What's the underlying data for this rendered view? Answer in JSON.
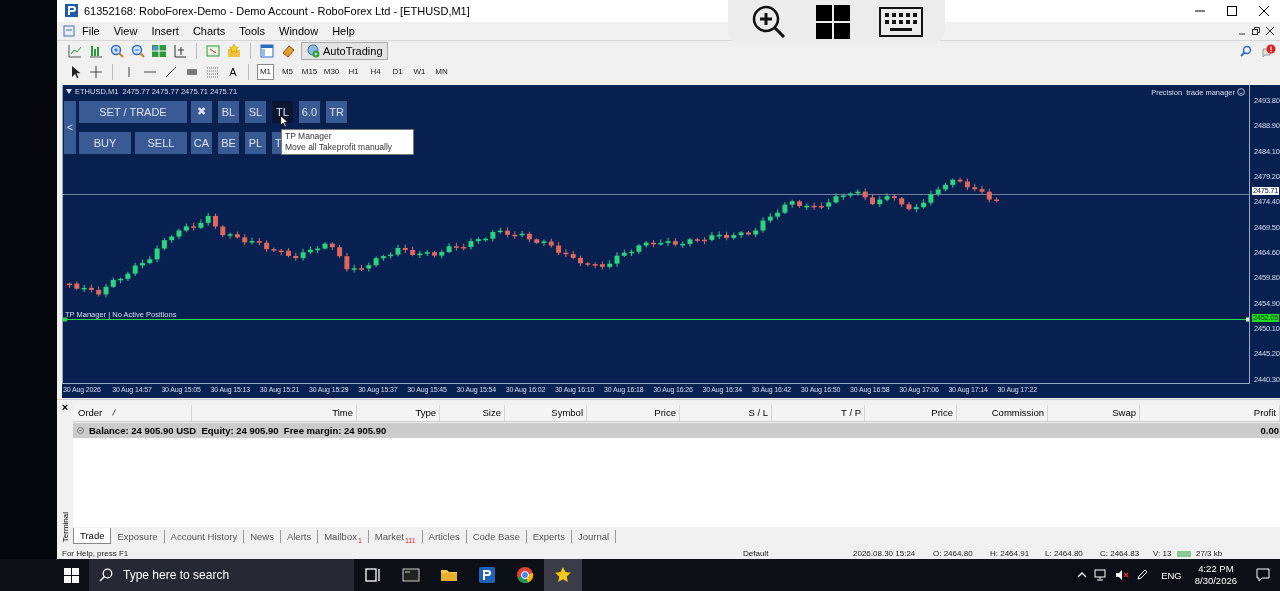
{
  "window": {
    "title": "61352168: RoboForex-Demo - Demo Account - RoboForex Ltd - [ETHUSD,M1]"
  },
  "menu": [
    "File",
    "View",
    "Insert",
    "Charts",
    "Tools",
    "Window",
    "Help"
  ],
  "toolbar": {
    "autotrading": "AutoTrading",
    "text_tool": "A"
  },
  "timeframes": [
    {
      "label": "M1",
      "selected": true
    },
    {
      "label": "M5",
      "selected": false
    },
    {
      "label": "M15",
      "selected": false
    },
    {
      "label": "M30",
      "selected": false
    },
    {
      "label": "H1",
      "selected": false
    },
    {
      "label": "H4",
      "selected": false
    },
    {
      "label": "D1",
      "selected": false
    },
    {
      "label": "W1",
      "selected": false
    },
    {
      "label": "MN",
      "selected": false
    }
  ],
  "chart": {
    "header": "ETHUSD,M1  2475.77 2475.77 2475.71 2475.71",
    "panel_title": "Precision  trade manager",
    "side_toggle": "<",
    "button_rows": [
      {
        "buttons": [
          {
            "label": "SET / TRADE",
            "kind": "wide",
            "highlighted": false
          },
          {
            "label": "✖",
            "kind": "small",
            "highlighted": false
          },
          {
            "label": "BL",
            "kind": "small",
            "highlighted": false
          },
          {
            "label": "SL",
            "kind": "small",
            "highlighted": false
          },
          {
            "label": "TL",
            "kind": "small",
            "highlighted": true
          },
          {
            "label": "6.0",
            "kind": "small",
            "highlighted": false
          },
          {
            "label": "TR",
            "kind": "small",
            "highlighted": false
          }
        ]
      },
      {
        "buttons": [
          {
            "label": "BUY",
            "kind": "half",
            "highlighted": false
          },
          {
            "label": "SELL",
            "kind": "half",
            "highlighted": false
          },
          {
            "label": "CA",
            "kind": "small",
            "highlighted": false
          },
          {
            "label": "BE",
            "kind": "small",
            "highlighted": false
          },
          {
            "label": "PL",
            "kind": "small",
            "highlighted": false
          },
          {
            "label": "T",
            "kind": "small",
            "highlighted": false
          }
        ]
      }
    ],
    "tooltip": {
      "title": "TP Manager",
      "text": "Move all Takeprofit manually"
    },
    "status_label": "TP Manager | No Active Positions",
    "price_ticks": [
      "2493.80",
      "2488.90",
      "2484.10",
      "2479.20",
      "2474.40",
      "2469.50",
      "2464.60",
      "2459.80",
      "2454.90",
      "2450.10",
      "2445.20",
      "2440.30"
    ],
    "bid_tag": "2475.71",
    "level_tag": "2452.05",
    "time_ticks": [
      "30 Aug 2026",
      "30 Aug 14:57",
      "30 Aug 15:05",
      "30 Aug 15:13",
      "30 Aug 15:21",
      "30 Aug 15:29",
      "30 Aug 15:37",
      "30 Aug 15:45",
      "30 Aug 15:54",
      "30 Aug 16:02",
      "30 Aug 16:10",
      "30 Aug 16:18",
      "30 Aug 16:26",
      "30 Aug 16:34",
      "30 Aug 16:42",
      "30 Aug 16:50",
      "30 Aug 16:58",
      "30 Aug 17:06",
      "30 Aug 17:14",
      "30 Aug 17:22"
    ]
  },
  "terminal": {
    "close": "×",
    "label": "Terminal",
    "columns": [
      "Order",
      "Time",
      "Type",
      "Size",
      "Symbol",
      "Price",
      "S / L",
      "T / P",
      "Price",
      "Commission",
      "Swap",
      "Profit"
    ],
    "balance_row": {
      "summary": "Balance: 24 905.90 USD  Equity: 24 905.90  Free margin: 24 905.90",
      "profit": "0.00"
    },
    "tabs": [
      {
        "label": "Trade",
        "selected": true
      },
      {
        "label": "Exposure",
        "selected": false
      },
      {
        "label": "Account History",
        "selected": false
      },
      {
        "label": "News",
        "selected": false
      },
      {
        "label": "Alerts",
        "selected": false
      },
      {
        "label": "Mailbox",
        "selected": false,
        "badge": "1"
      },
      {
        "label": "Market",
        "selected": false,
        "badge": "111"
      },
      {
        "label": "Articles",
        "selected": false
      },
      {
        "label": "Code Base",
        "selected": false
      },
      {
        "label": "Experts",
        "selected": false
      },
      {
        "label": "Journal",
        "selected": false
      }
    ]
  },
  "status_bar": [
    "For Help, press F1",
    "Default",
    "2026.08.30 15:24",
    "O: 2464.80",
    "H: 2464.91",
    "L: 2464.80",
    "C: 2464.83",
    "V: 13",
    "27/3 kb"
  ],
  "taskbar": {
    "search_placeholder": "Type here to search",
    "language": "ENG",
    "time": "4:22 PM",
    "date": "8/30/2026"
  }
}
